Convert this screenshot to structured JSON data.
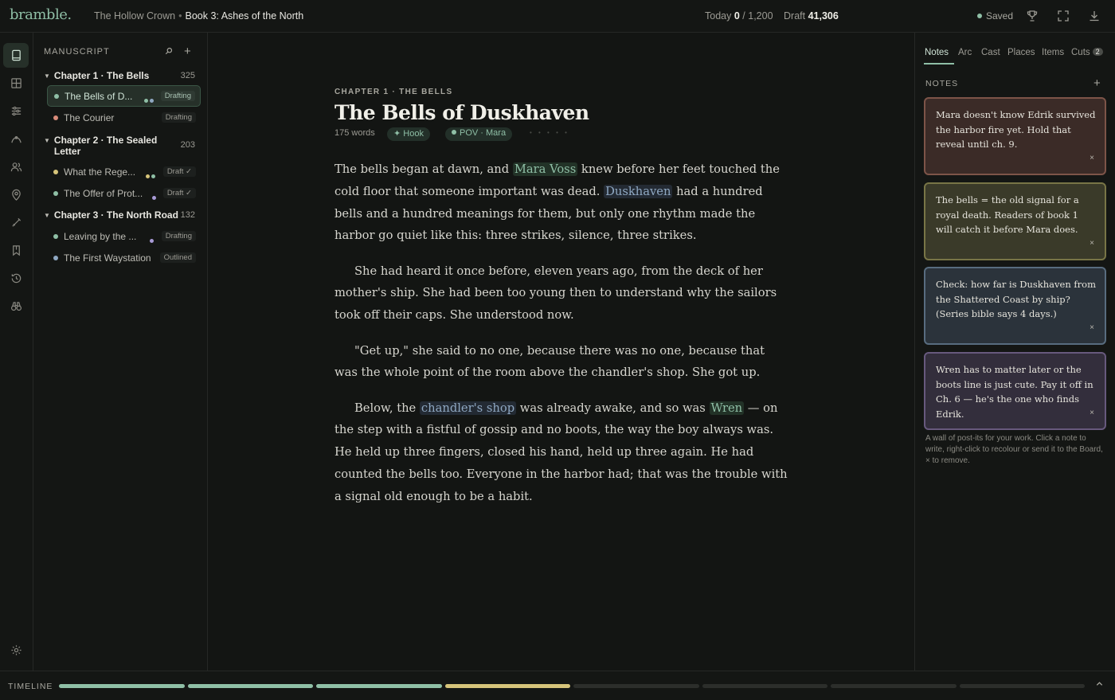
{
  "app": {
    "logo": "bramble."
  },
  "breadcrumb": {
    "series": "The Hollow Crown",
    "separator": "•",
    "book": "Book 3: Ashes of the North"
  },
  "counts": {
    "today_label": "Today",
    "today_value": "0",
    "slash": "/",
    "today_goal": "1,200",
    "draft_label": "Draft",
    "draft_value": "41,306"
  },
  "status": {
    "saved": "Saved"
  },
  "topbar_icons": [
    "trophy-icon",
    "fullscreen-icon",
    "download-icon"
  ],
  "rail": {
    "items": [
      "manuscript-icon",
      "board-icon",
      "sliders-icon",
      "arc-icon",
      "cast-icon",
      "places-icon",
      "items-icon",
      "cuts-icon",
      "history-icon",
      "binoculars-icon"
    ],
    "bottom": "settings-icon"
  },
  "sidebar": {
    "heading": "MANUSCRIPT",
    "chapters": [
      {
        "title": "Chapter 1 · The Bells",
        "words": "325"
      },
      {
        "title": "Chapter 2 · The Sealed Letter",
        "words": "203"
      },
      {
        "title": "Chapter 3 · The North Road",
        "words": "132"
      }
    ],
    "scenes": [
      {
        "name": "The Bells of D...",
        "status": "Drafting",
        "dot": "#8fbfa6",
        "marks": [
          "#8fbfa6",
          "#8fa8c2"
        ]
      },
      {
        "name": "The Courier",
        "status": "Drafting",
        "dot": "#d98c7a",
        "marks": []
      },
      {
        "name": "What the Rege...",
        "status": "Draft ✓",
        "dot": "#d6c47a",
        "marks": [
          "#d6c47a",
          "#8fbfa6"
        ]
      },
      {
        "name": "The Offer of Prot...",
        "status": "Draft ✓",
        "dot": "#8fbfa6",
        "marks": [
          "#a89ad6"
        ]
      },
      {
        "name": "Leaving by the ...",
        "status": "Drafting",
        "dot": "#8fbfa6",
        "marks": [
          "#a89ad6"
        ]
      },
      {
        "name": "The First Waystation",
        "status": "Outlined",
        "dot": "#8fa8c2",
        "marks": []
      }
    ]
  },
  "editor": {
    "eyebrow": "CHAPTER 1 · THE BELLS",
    "title": "The Bells of Duskhaven",
    "word_count": "175 words",
    "tags": [
      "Hook",
      "POV · Mara"
    ],
    "rating": "• • • • •",
    "paragraphs": [
      {
        "a": "The bells began at dawn, and ",
        "e1": "Mara Voss",
        "b": " knew before her feet touched the cold floor that someone important was dead. ",
        "e2": "Duskhaven",
        "c": " had a hundred bells and a hundred meanings for them, but only one rhythm made the harbor go quiet like this: three strikes, silence, three strikes."
      },
      {
        "text": "She had heard it once before, eleven years ago, from the deck of her mother's ship. She had been too young then to understand why the sailors took off their caps. She understood now."
      },
      {
        "text": "\"Get up,\" she said to no one, because there was no one, because that was the whole point of the room above the chandler's shop. She got up."
      },
      {
        "a": "Below, the ",
        "e1": "chandler's shop",
        "b": " was already awake, and so was ",
        "e2": "Wren",
        "c": " — on the step with a fistful of gossip and no boots, the way the boy always was. He held up three fingers, closed his hand, held up three again. He had counted the bells too. Everyone in the harbor had; that was the trouble with a signal old enough to be a habit."
      }
    ]
  },
  "right_panel": {
    "tabs": [
      "Notes",
      "Arc",
      "Cast",
      "Places",
      "Items",
      "Cuts"
    ],
    "cuts_count": "2",
    "notes_heading": "NOTES",
    "notes": [
      {
        "text": "Mara doesn't know Edrik survived the harbor fire yet. Hold that reveal until ch. 9.",
        "bg": "#3b2b27",
        "border": "#7d5448"
      },
      {
        "text": "The bells = the old signal for a royal death. Readers of book 1 will catch it before Mara does.",
        "bg": "#3a3a29",
        "border": "#787546"
      },
      {
        "text": "Check: how far is Duskhaven from the Shattered Coast by ship? (Series bible says 4 days.)",
        "bg": "#2b333b",
        "border": "#586c7f"
      },
      {
        "text": "Wren has to matter later or the boots line is just cute. Pay it off in Ch. 6 — he's the one who finds Edrik.",
        "bg": "#332e3c",
        "border": "#67597d"
      }
    ],
    "close_glyph": "×",
    "help": "A wall of post-its for your work. Click a note to write, right-click to recolour or send it to the Board, × to remove."
  },
  "timeline": {
    "label": "TIMELINE",
    "segments": [
      "#8fbfa6",
      "#8fbfa6",
      "#8fbfa6",
      "#d6c47a",
      "#2c2e2b",
      "#2c2e2b",
      "#2c2e2b",
      "#2c2e2b"
    ]
  }
}
